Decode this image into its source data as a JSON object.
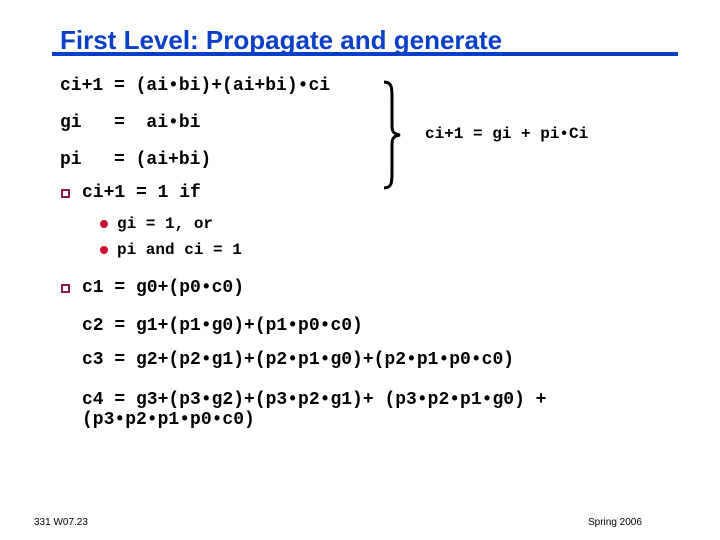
{
  "slide": {
    "title": "First Level: Propagate and generate",
    "equations_left": [
      "ci+1 = (ai•bi)+(ai+bi)•ci",
      "gi   =  ai•bi",
      "pi   = (ai+bi)"
    ],
    "brace_result": "ci+1 = gi + pi•Ci",
    "bullet1": {
      "text": "ci+1 = 1 if",
      "sub": [
        "gi = 1, or",
        "pi and ci = 1"
      ]
    },
    "bullet2": {
      "lines": [
        "c1 = g0+(p0•c0)",
        "c2 = g1+(p1•g0)+(p1•p0•c0)",
        "c3 = g2+(p2•g1)+(p2•p1•g0)+(p2•p1•p0•c0)",
        "c4 = g3+(p3•g2)+(p3•p2•g1)+ (p3•p2•p1•g0) +",
        "(p3•p2•p1•p0•c0)"
      ]
    },
    "footer_left": "331  W07.23",
    "footer_right": "Spring 2006",
    "icons": {
      "bullet_level1": "hollow-square",
      "bullet_level2": "red-dot",
      "brace": "right-curly-brace"
    },
    "colors": {
      "title": "#0b3fc7",
      "bullet_square": "#8b1c3f",
      "bullet_dot": "#d0102a"
    }
  }
}
